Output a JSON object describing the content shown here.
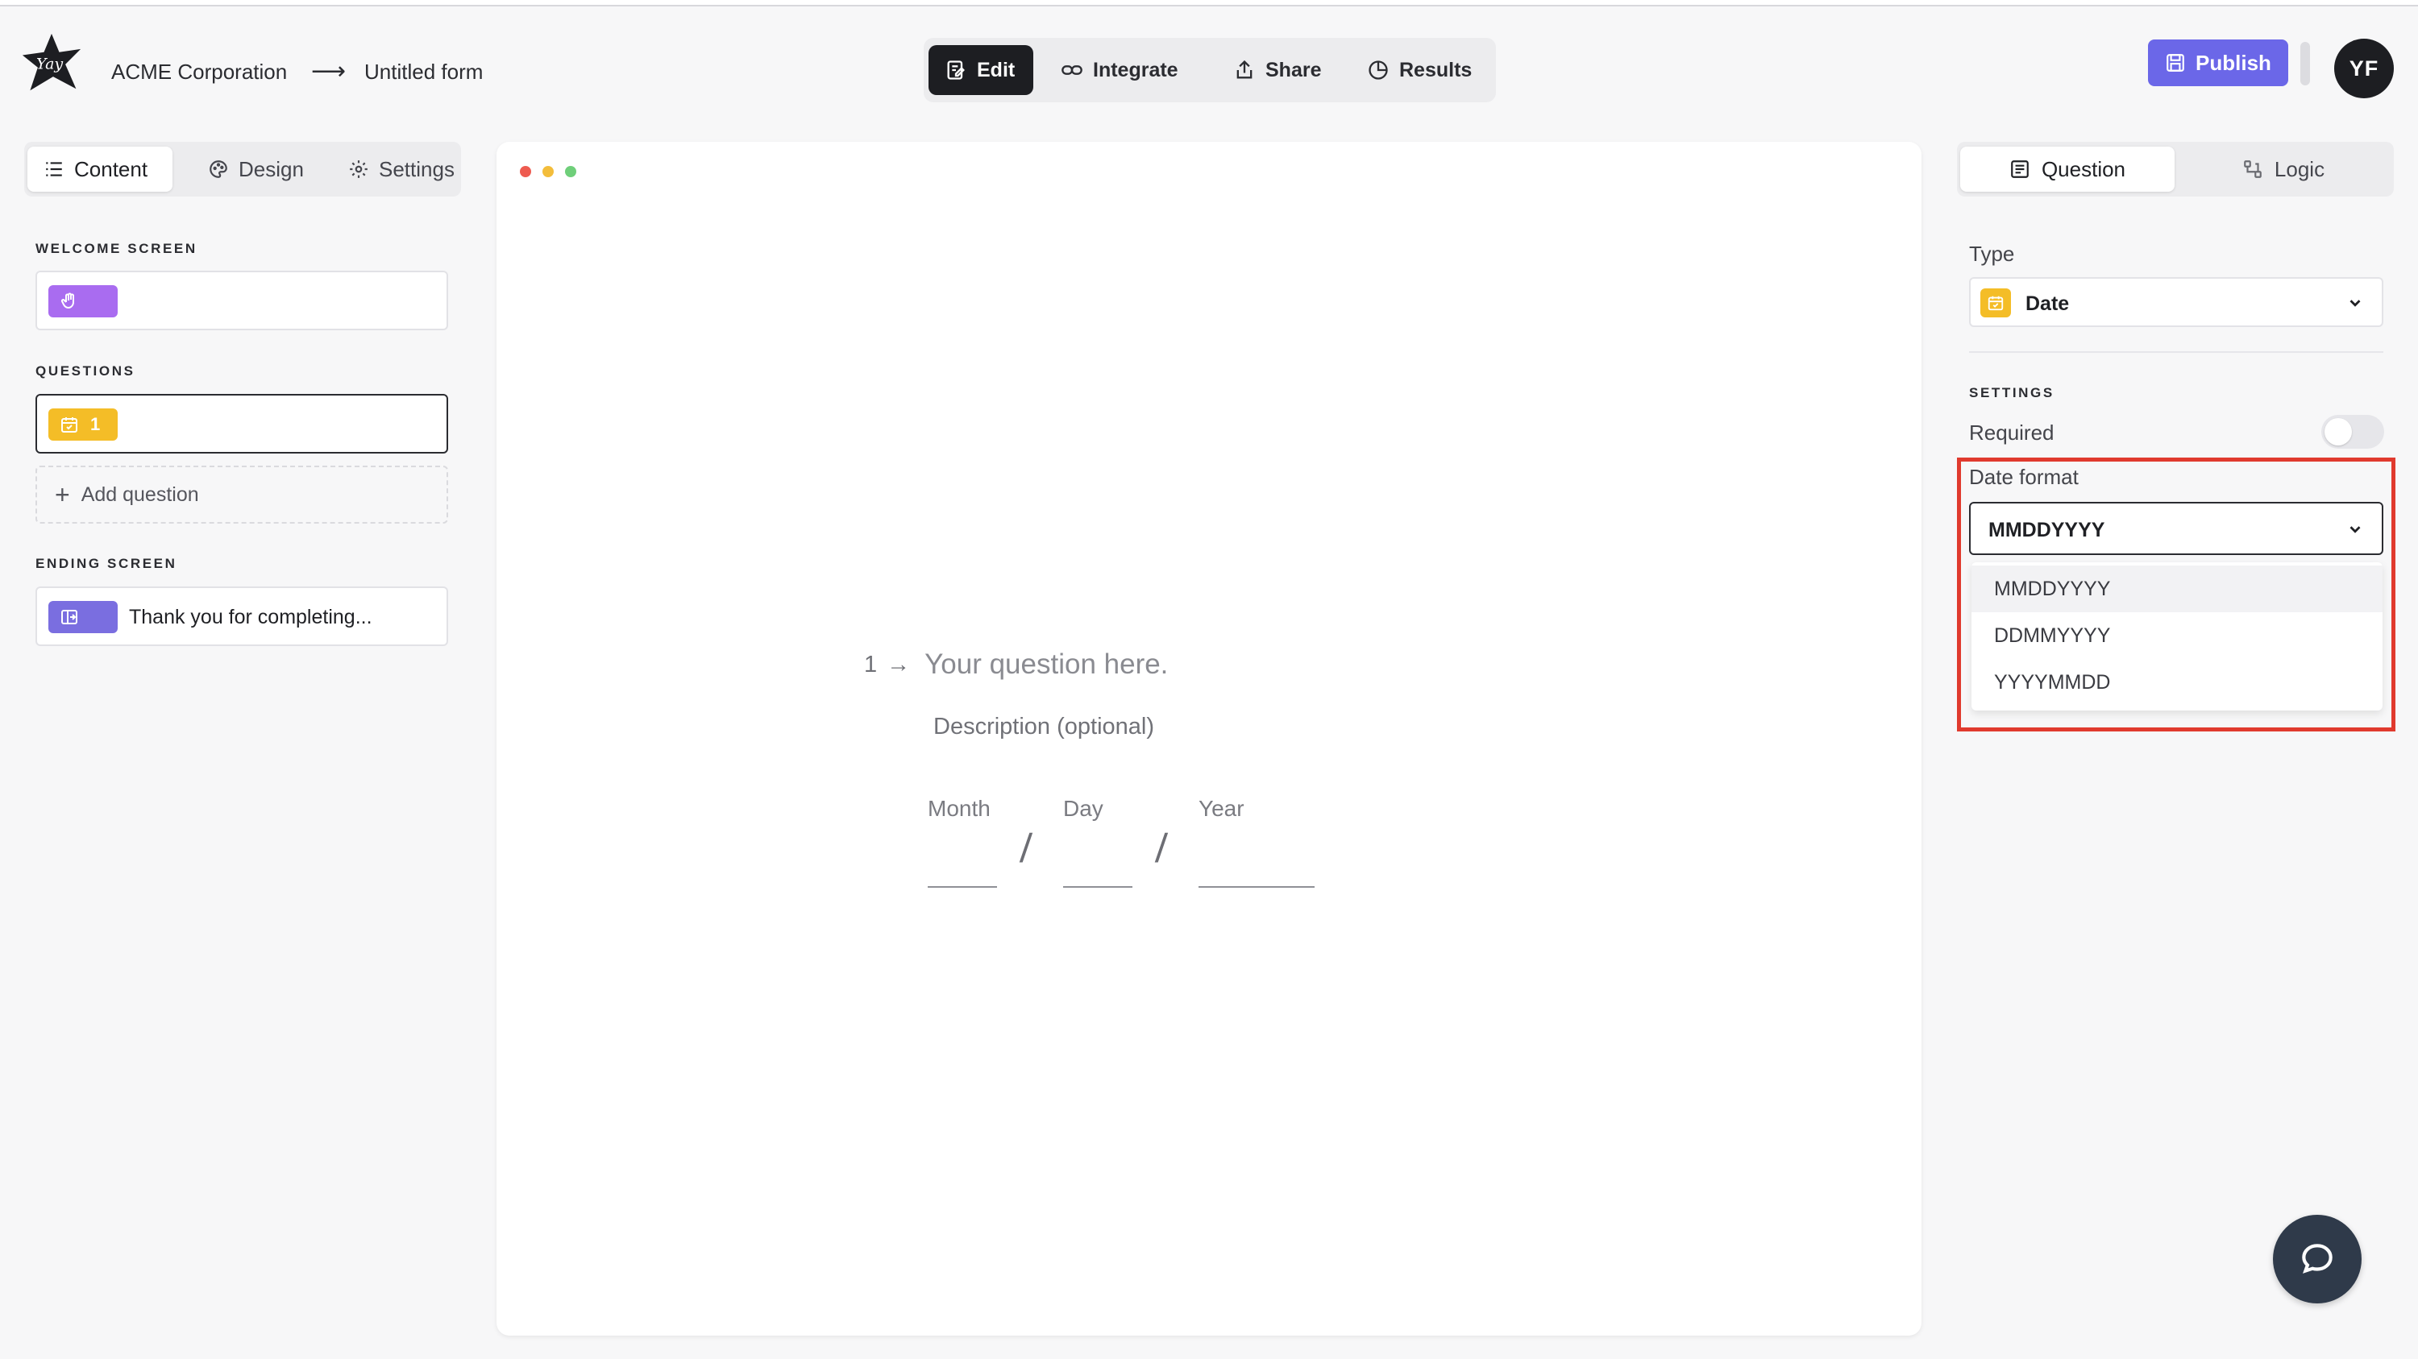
{
  "header": {
    "org_name": "ACME Corporation",
    "crumb_arrow": "⟶",
    "form_name": "Untitled form",
    "modes": [
      "Edit",
      "Integrate",
      "Share",
      "Results"
    ],
    "active_mode": "Edit",
    "publish_label": "Publish",
    "avatar_initials": "YF"
  },
  "left_panel": {
    "tabs": [
      "Content",
      "Design",
      "Settings"
    ],
    "active_tab": "Content",
    "welcome_label": "WELCOME SCREEN",
    "questions_label": "QUESTIONS",
    "question_number": "1",
    "add_question_label": "Add question",
    "ending_label": "ENDING SCREEN",
    "ending_text": "Thank you for completing..."
  },
  "canvas": {
    "question_number": "1",
    "arrow": "→",
    "question_text": "Your question here.",
    "description": "Description (optional)",
    "date_fields": [
      "Month",
      "Day",
      "Year"
    ],
    "separator": "/"
  },
  "right_panel": {
    "tabs": [
      "Question",
      "Logic"
    ],
    "active_tab": "Question",
    "type_label": "Type",
    "type_value": "Date",
    "settings_label": "SETTINGS",
    "required_label": "Required",
    "required_on": false,
    "date_format_label": "Date format",
    "date_format_value": "MMDDYYYY",
    "date_format_options": [
      "MMDDYYYY",
      "DDMMYYYY",
      "YYYYMMDD"
    ]
  },
  "colors": {
    "accent": "#6b67e8",
    "date_chip": "#f4bd27",
    "welcome_chip": "#a96cf0",
    "ending_chip": "#7a6ee0",
    "highlight": "#e03a2e",
    "dark": "#1d1e22"
  },
  "icons": {
    "logo": "star-logo-icon",
    "edit": "edit-icon",
    "integrate": "link-icon",
    "share": "share-icon",
    "results": "chart-icon",
    "publish": "save-icon",
    "help": "chat-icon"
  }
}
